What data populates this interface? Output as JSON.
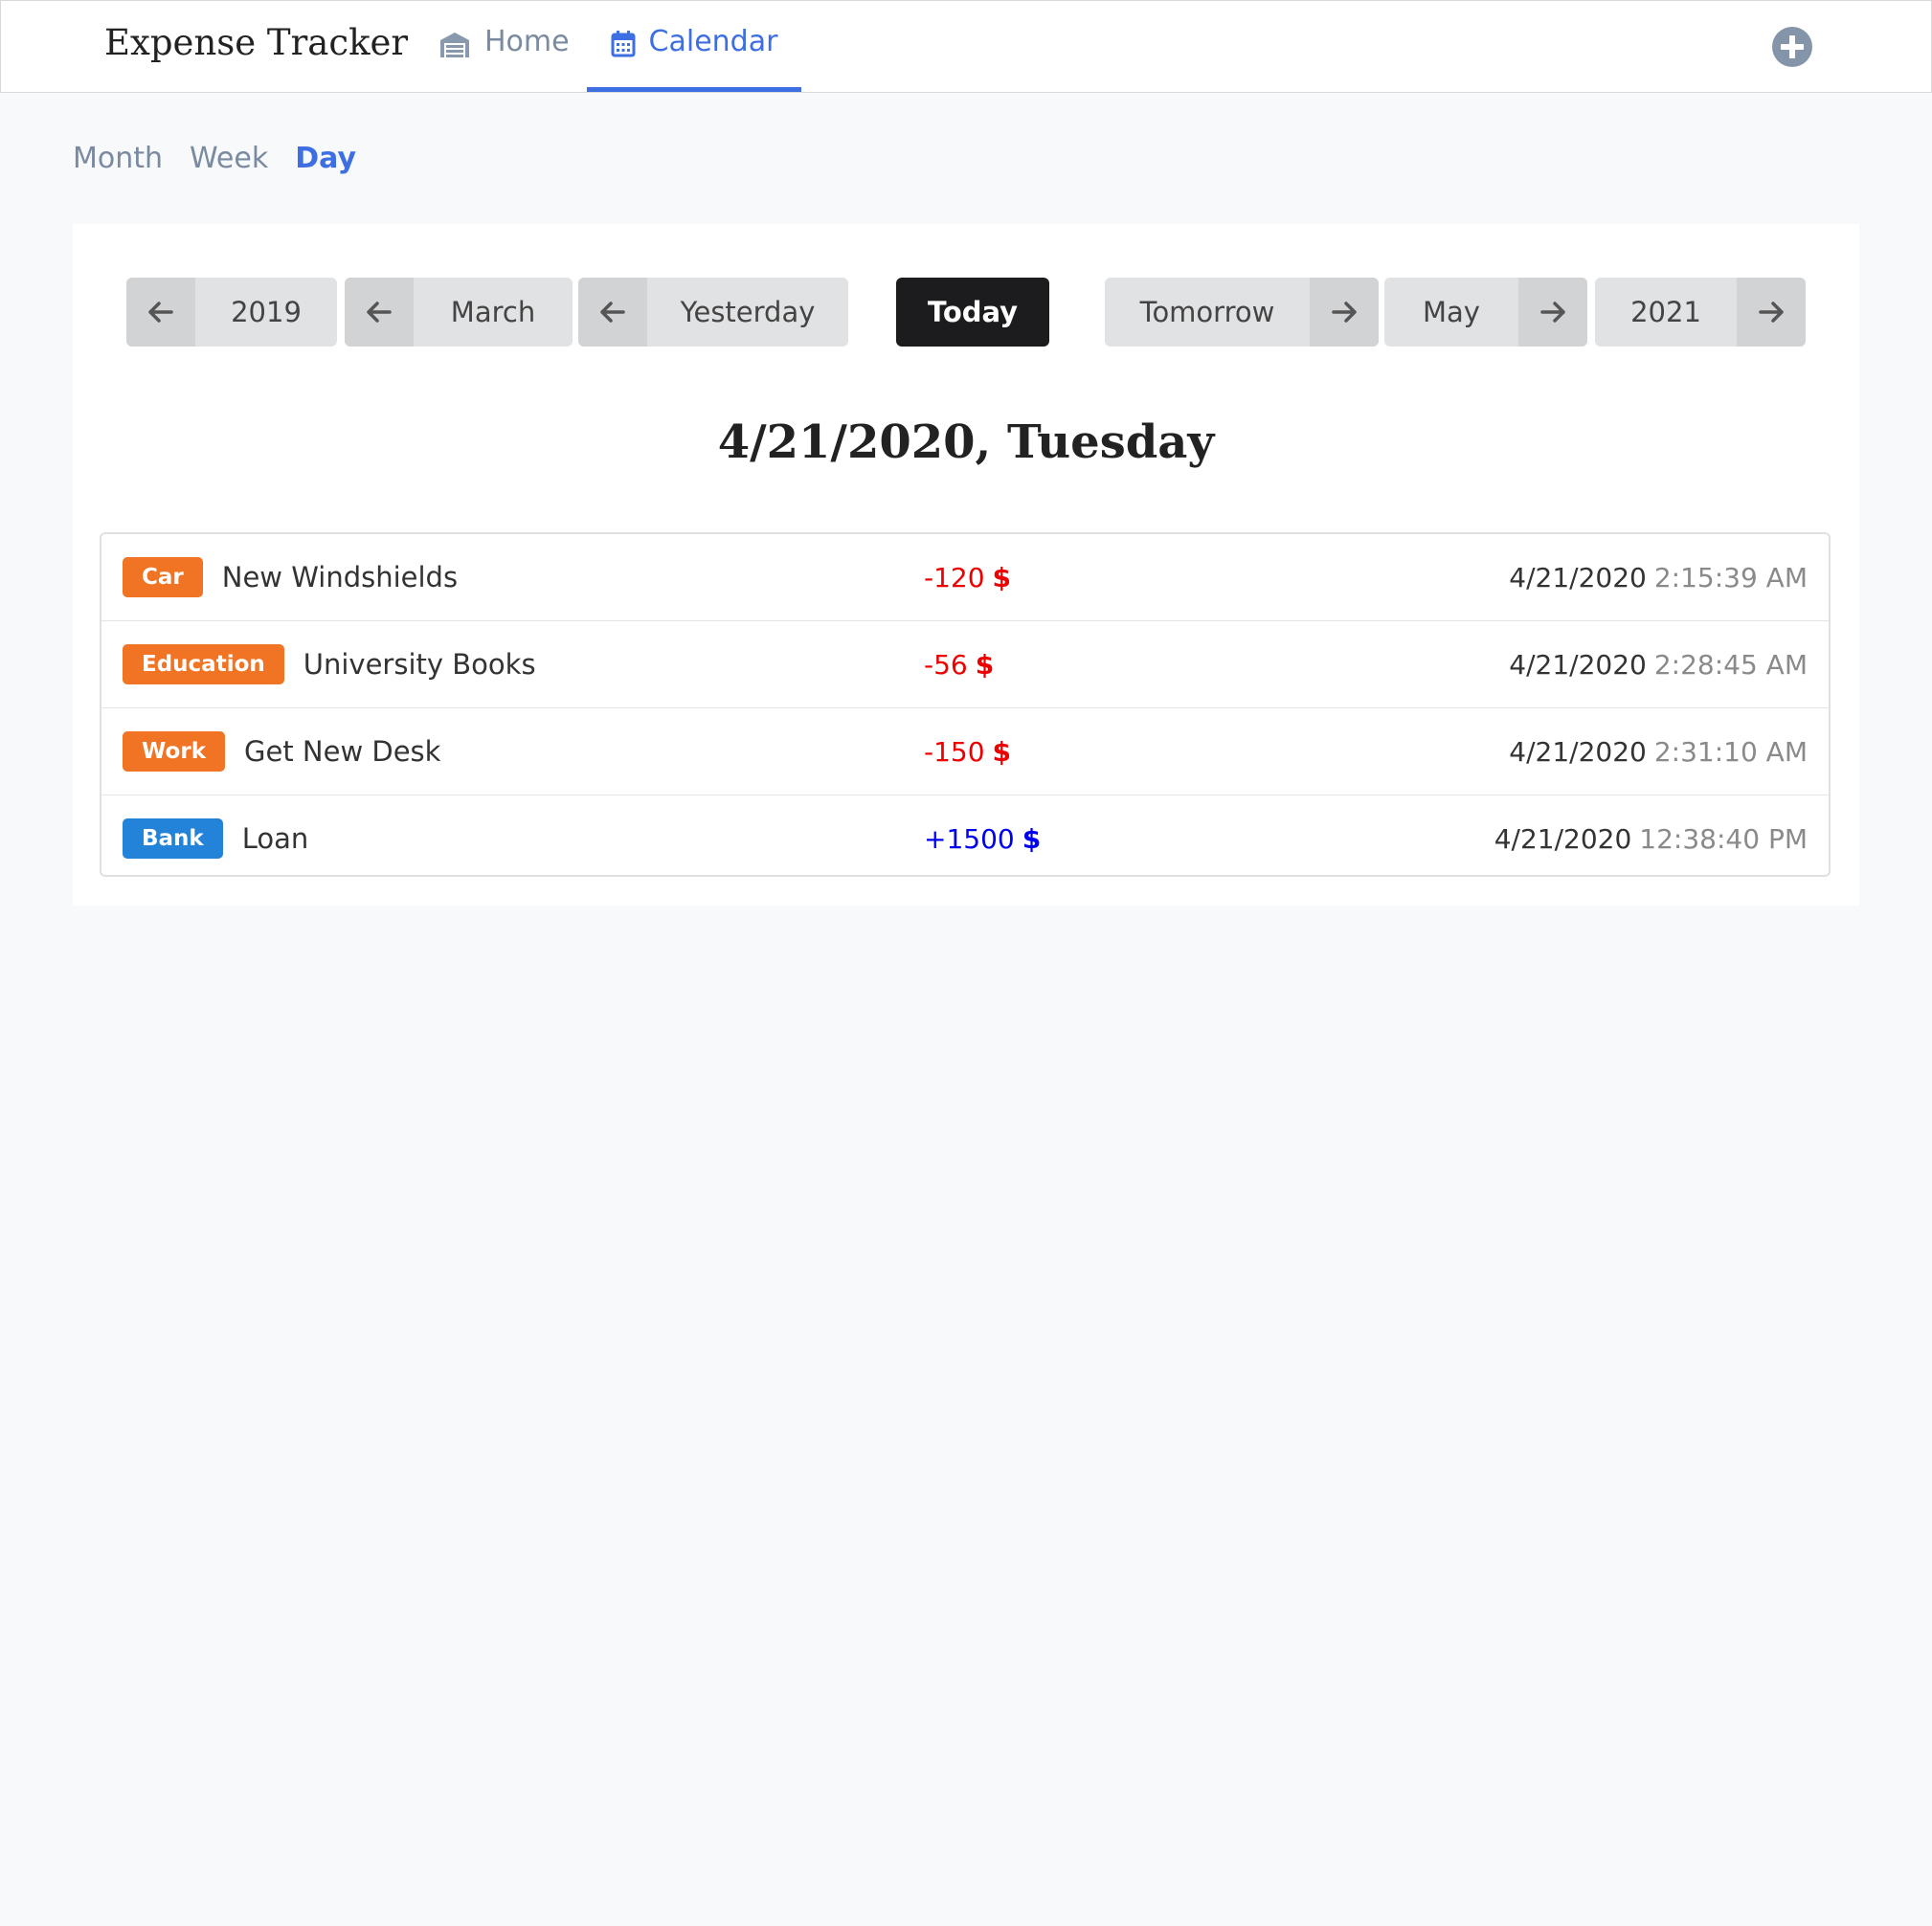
{
  "app": {
    "title": "Expense Tracker"
  },
  "nav": {
    "home_label": "Home",
    "calendar_label": "Calendar",
    "active": "Calendar"
  },
  "view_tabs": [
    {
      "label": "Month"
    },
    {
      "label": "Week"
    },
    {
      "label": "Day",
      "active": true
    }
  ],
  "date_nav": {
    "prev_year": "2019",
    "prev_month": "March",
    "prev_day": "Yesterday",
    "today": "Today",
    "next_day": "Tomorrow",
    "next_month": "May",
    "next_year": "2021"
  },
  "day_title": "4/21/2020, Tuesday",
  "transactions": [
    {
      "category": "Car",
      "category_color": "#f07423",
      "description": "New Windshields",
      "amount": "-120",
      "currency": "$",
      "amount_color": "#ee0000",
      "date": "4/21/2020",
      "time": "2:15:39 AM"
    },
    {
      "category": "Education",
      "category_color": "#f07423",
      "description": "University Books",
      "amount": "-56",
      "currency": "$",
      "amount_color": "#ee0000",
      "date": "4/21/2020",
      "time": "2:28:45 AM"
    },
    {
      "category": "Work",
      "category_color": "#f07423",
      "description": "Get New Desk",
      "amount": "-150",
      "currency": "$",
      "amount_color": "#ee0000",
      "date": "4/21/2020",
      "time": "2:31:10 AM"
    },
    {
      "category": "Bank",
      "category_color": "#2283d8",
      "description": "Loan",
      "amount": "+1500",
      "currency": "$",
      "amount_color": "#0000ee",
      "date": "4/21/2020",
      "time": "12:38:40 PM"
    }
  ],
  "icons": {
    "home": "garage-icon",
    "calendar": "calendar-icon",
    "add": "plus-circle-icon",
    "prev": "arrow-left-icon",
    "next": "arrow-right-icon"
  },
  "colors": {
    "accent": "#3d6fe3",
    "expense": "#ee0000",
    "income": "#0000ee",
    "today_bg": "#1c1c1e"
  }
}
